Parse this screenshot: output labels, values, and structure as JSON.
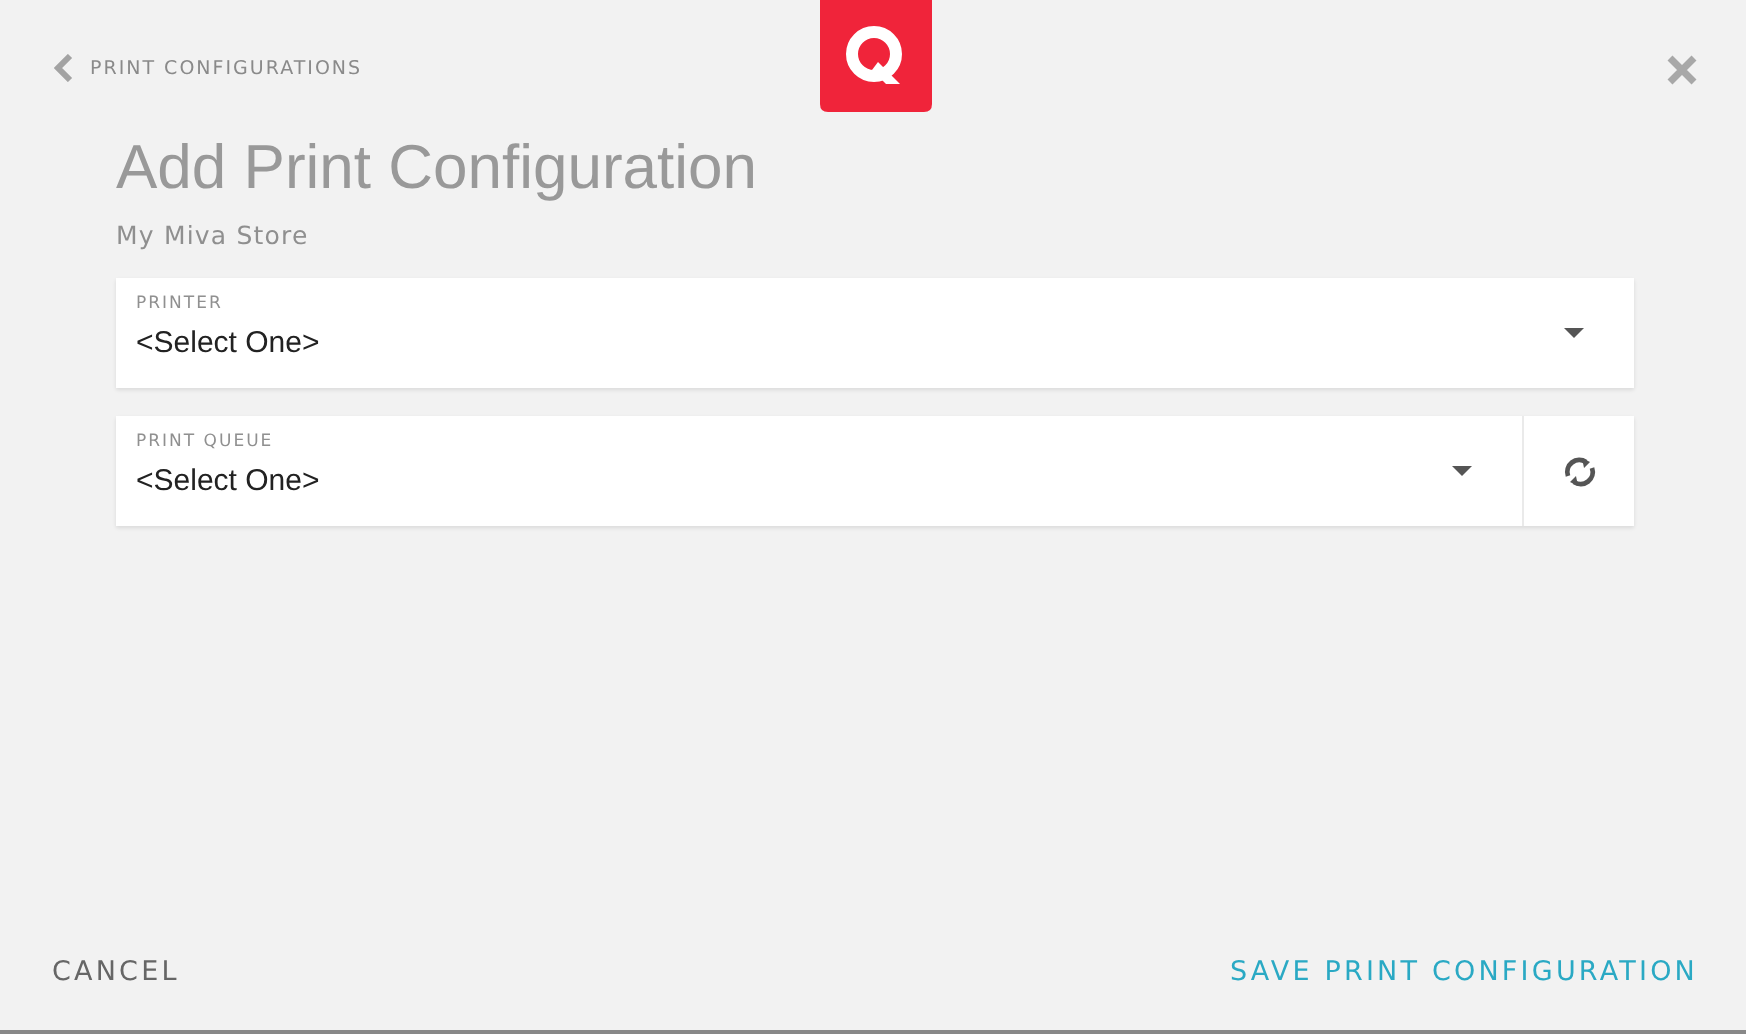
{
  "back_link": {
    "label": "PRINT CONFIGURATIONS"
  },
  "title": "Add Print Configuration",
  "subtitle": "My Miva Store",
  "fields": [
    {
      "kind": "select",
      "label": "PRINTER",
      "value": "<Select One>"
    },
    {
      "kind": "select_refresh",
      "label": "PRINT QUEUE",
      "value": "<Select One>"
    }
  ],
  "footer": {
    "cancel": "CANCEL",
    "save": "SAVE PRINT CONFIGURATION"
  }
}
